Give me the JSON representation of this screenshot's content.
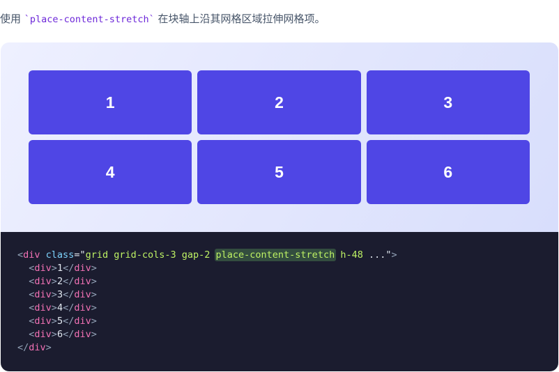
{
  "intro": {
    "before": "使用 ",
    "code": "`place-content-stretch`",
    "after": " 在块轴上沿其网格区域拉伸网格项。"
  },
  "preview": {
    "items": [
      "1",
      "2",
      "3",
      "4",
      "5",
      "6"
    ]
  },
  "code": {
    "lt": "<",
    "gt": ">",
    "close_lt": "</",
    "tag": "div",
    "attr_name": "class",
    "eq_quote": "=\"",
    "class_pre": "grid grid-cols-3 gap-2 ",
    "class_hl": "place-content-stretch",
    "class_post": " h-48 ",
    "ellipsis": "...",
    "end_quote": "\"",
    "children": [
      "1",
      "2",
      "3",
      "4",
      "5",
      "6"
    ]
  },
  "colors": {
    "accent": "#4f46e5",
    "code_bg": "#1b1c2f",
    "highlight_bg": "#334d3f"
  }
}
